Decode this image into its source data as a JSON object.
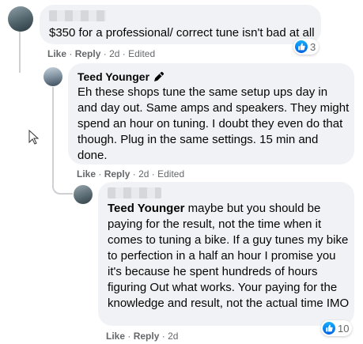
{
  "comments": [
    {
      "author": "",
      "text": "$350 for a professional/ correct tune isn't bad at all",
      "actions": {
        "like": "Like",
        "reply": "Reply",
        "time": "2d",
        "edited": "Edited"
      },
      "reaction_count": "3"
    },
    {
      "author": "Teed Younger",
      "text": "Eh these shops tune the same setup ups day in and day out. Same amps and speakers. They might spend an hour on tuning. I doubt they even do that though. Plug in the same settings. 15 min and done.",
      "actions": {
        "like": "Like",
        "reply": "Reply",
        "time": "2d",
        "edited": "Edited"
      }
    },
    {
      "author": "",
      "mention": "Teed Younger",
      "text": " maybe but you should be paying for the result, not the time when it comes to tuning a bike. If a guy tunes my bike to perfection in a half an hour I promise you it's because he spent hundreds of hours figuring Out what works. Your paying for the knowledge and result, not the actual time IMO",
      "actions": {
        "like": "Like",
        "reply": "Reply",
        "time": "2d"
      },
      "reaction_count": "10"
    }
  ],
  "separator": "·",
  "colors": {
    "bubble": "#f0f2f5",
    "meta": "#65676b",
    "like_blue": "#1877f2"
  },
  "icons": [
    "author-badge-icon",
    "like-reaction-icon",
    "mouse-cursor-icon"
  ]
}
